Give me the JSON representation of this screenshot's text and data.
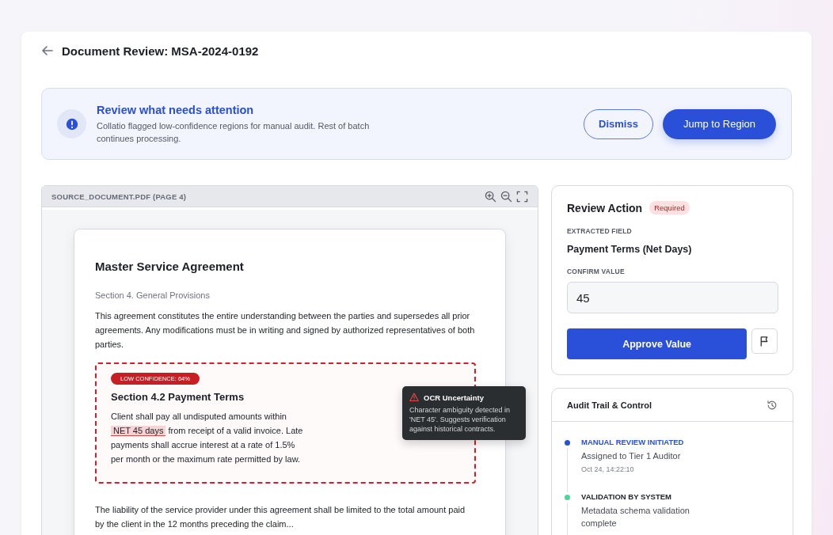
{
  "header": {
    "title": "Document Review: MSA-2024-0192"
  },
  "banner": {
    "title": "Review what needs attention",
    "message": "Collatio flagged low-confidence regions for manual audit. Rest of batch continues processing.",
    "buttons": [
      {
        "label": "Dismiss",
        "kind": "secondary"
      },
      {
        "label": "Jump to Region",
        "kind": "primary"
      }
    ]
  },
  "viewer": {
    "title": "SOURCE_DOCUMENT.PDF (PAGE 4)",
    "document": {
      "title": "Master Service Agreement",
      "section": "Section 4. General Provisions",
      "intro": "This agreement constitutes the entire understanding between the parties and supersedes all prior agreements. Any modifications must be in writing and signed by authorized representatives of both parties.",
      "flagged_region": {
        "badge": "LOW CONFIDENCE: 64%",
        "heading": "Section 4.2 Payment Terms",
        "body": [
          {
            "text": "Client shall pay all undisputed amounts within ",
            "highlighted": false
          },
          {
            "text": "NET 45 days",
            "highlighted": true
          },
          {
            "text": " from receipt of a valid invoice. Late payments shall accrue interest at a rate of 1.5% per month or the maximum rate permitted by law.",
            "highlighted": false
          }
        ]
      },
      "tooltip": {
        "title": "OCR Uncertainty",
        "text": "Character ambiguity detected in 'NET 45'. Suggests verification against historical contracts."
      },
      "closing": "The liability of the service provider under this agreement shall be limited to the total amount paid by the client in the 12 months preceding the claim..."
    }
  },
  "review": {
    "title": "Review Action",
    "badge": "Required",
    "field_label": "EXTRACTED FIELD",
    "field_name": "Payment Terms (Net Days)",
    "value_label": "CONFIRM VALUE",
    "value": "45",
    "approve": "Approve Value"
  },
  "audit": {
    "title": "Audit Trail & Control",
    "events": [
      {
        "title": "MANUAL REVIEW INITIATED",
        "detail": "Assigned to Tier 1 Auditor",
        "time": "Oct 24, 14:22:10",
        "color": "#2a4fd8",
        "selected": true
      },
      {
        "title": "VALIDATION BY SYSTEM",
        "detail": "Metadata schema validation complete",
        "color": "#4ad79a",
        "selected": false
      }
    ]
  }
}
